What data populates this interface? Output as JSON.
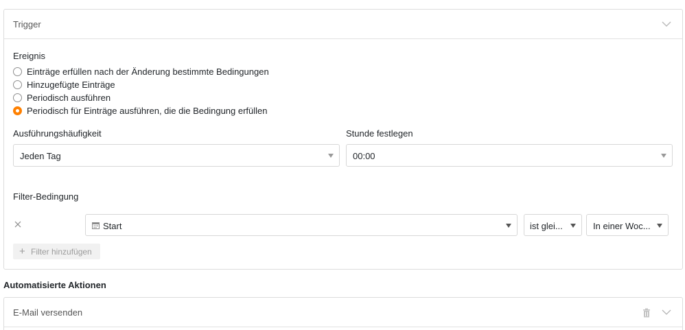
{
  "trigger": {
    "title": "Trigger",
    "event_label": "Ereignis",
    "options": [
      {
        "label": "Einträge erfüllen nach der Änderung bestimmte Bedingungen",
        "selected": false
      },
      {
        "label": "Hinzugefügte Einträge",
        "selected": false
      },
      {
        "label": "Periodisch ausführen",
        "selected": false
      },
      {
        "label": "Periodisch für Einträge ausführen, die die Bedingung erfüllen",
        "selected": true
      }
    ],
    "frequency_label": "Ausführungshäufigkeit",
    "frequency_value": "Jeden Tag",
    "hour_label": "Stunde festlegen",
    "hour_value": "00:00",
    "filter_label": "Filter-Bedingung",
    "filter": {
      "column": "Start",
      "operator": "ist glei...",
      "value": "In einer Woc..."
    },
    "add_filter_label": "Filter hinzufügen"
  },
  "actions": {
    "title": "Automatisierte Aktionen",
    "items": [
      {
        "label": "E-Mail versenden"
      }
    ]
  },
  "colors": {
    "accent": "#ff8000",
    "border": "#dcdcdc"
  },
  "icons": [
    "chevron-down-icon",
    "close-icon",
    "calendar-icon",
    "plus-icon",
    "trash-icon"
  ]
}
